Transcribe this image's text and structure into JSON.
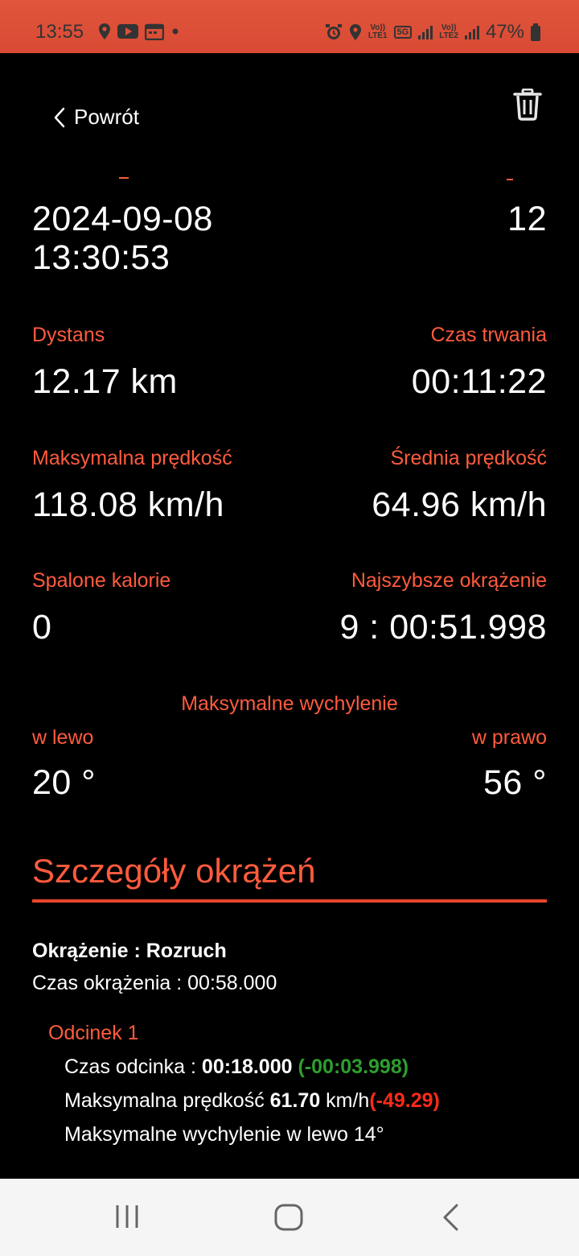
{
  "status": {
    "time": "13:55",
    "lte1": "LTE1",
    "lte2": "LTE2",
    "net": "5G",
    "battery": "47%",
    "volte": "Vo))"
  },
  "header": {
    "back_label": "Powrót"
  },
  "summary": {
    "start_date": "2024-09-08",
    "start_time": "13:30:53",
    "laps_value": "12",
    "distance_label": "Dystans",
    "distance_value": "12.17 km",
    "duration_label": "Czas trwania",
    "duration_value": "00:11:22",
    "max_speed_label": "Maksymalna prędkość",
    "max_speed_value": "118.08 km/h",
    "avg_speed_label": "Średnia prędkość",
    "avg_speed_value": "64.96 km/h",
    "calories_label": "Spalone kalorie",
    "calories_value": "0",
    "fastest_lap_label": "Najszybsze okrążenie",
    "fastest_lap_value": "9 : 00:51.998",
    "max_lean_label": "Maksymalne wychylenie",
    "left_label": "w lewo",
    "left_value": "20 °",
    "right_label": "w prawo",
    "right_value": "56 °"
  },
  "laps": {
    "section_title": "Szczegóły okrążeń",
    "lap_title": "Okrążenie : Rozruch",
    "lap_time": "Czas okrążenia : 00:58.000",
    "segment_title": "Odcinek 1",
    "seg_time_label": "Czas odcinka : ",
    "seg_time_value": "00:18.000",
    "seg_time_delta": "(-00:03.998)",
    "seg_speed_label": "Maksymalna prędkość ",
    "seg_speed_value": "61.70",
    "seg_speed_unit": " km/h",
    "seg_speed_delta": "(-49.29)",
    "seg_lean": "Maksymalne wychylenie w lewo 14°"
  },
  "colors": {
    "accent": "#ff5b3d",
    "positive": "#2e9e2e",
    "negative": "#ff2a1a"
  }
}
